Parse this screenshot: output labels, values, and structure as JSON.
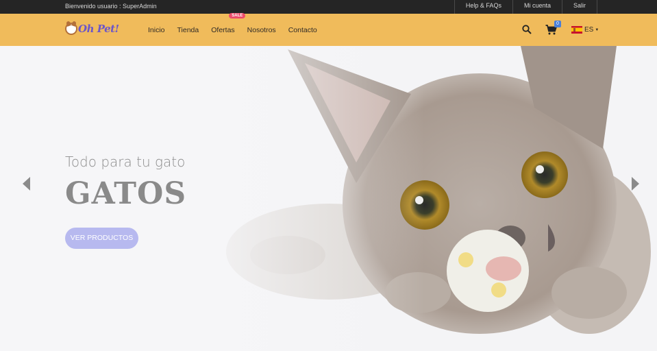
{
  "topbar": {
    "welcome": "Bienvenido usuario : SuperAdmin",
    "links": [
      "Help & FAQs",
      "Mi cuenta",
      "Salir"
    ]
  },
  "header": {
    "logo_text": "Oh Pet!",
    "nav": [
      "Inicio",
      "Tienda",
      "Ofertas",
      "Nosotros",
      "Contacto"
    ],
    "sale_badge": "SALE",
    "cart_count": "0",
    "language": "ES"
  },
  "hero": {
    "subtitle": "Todo para tu gato",
    "title": "GATOS",
    "button": "VER PRODUCTOS"
  },
  "icons": {
    "search": "search-icon",
    "cart": "cart-icon",
    "prev": "chevron-left-icon",
    "next": "chevron-right-icon"
  },
  "colors": {
    "header_bg": "#f0bb5b",
    "topbar_bg": "#252525",
    "button_bg": "#b7b9ef",
    "sale_badge": "#ee4d6c"
  }
}
